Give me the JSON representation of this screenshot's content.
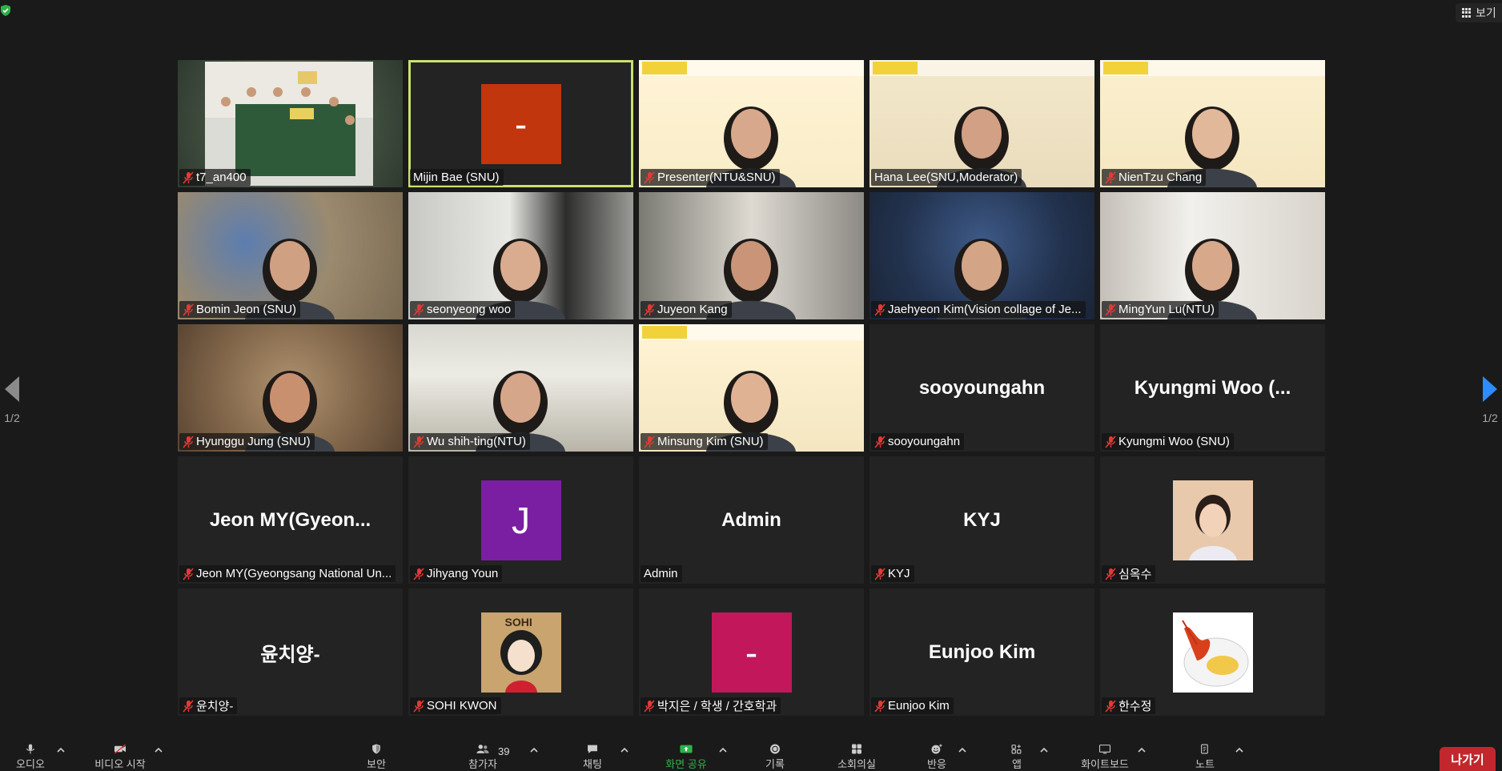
{
  "top": {
    "view_label": "보기"
  },
  "pagination": {
    "left": "1/2",
    "right": "1/2"
  },
  "colors": {
    "speaking_border": "#c9e06f",
    "leave_button": "#c1272d",
    "muted_mic": "#e53935",
    "share_green": "#2cb34a",
    "nav_arrow_right": "#2d8cff"
  },
  "participants": [
    {
      "name": "t7_an400",
      "muted": true,
      "type": "video"
    },
    {
      "name": "Mijin Bae (SNU)",
      "muted": false,
      "type": "square",
      "initial": "-",
      "color": "#c1360c",
      "speaking": true
    },
    {
      "name": "Presenter(NTU&SNU)",
      "muted": true,
      "type": "video"
    },
    {
      "name": "Hana Lee(SNU,Moderator)",
      "muted": false,
      "type": "video"
    },
    {
      "name": "NienTzu Chang",
      "muted": true,
      "type": "video"
    },
    {
      "name": "Bomin Jeon (SNU)",
      "muted": true,
      "type": "video"
    },
    {
      "name": "seonyeong woo",
      "muted": true,
      "type": "video"
    },
    {
      "name": "Juyeon Kang",
      "muted": true,
      "type": "video"
    },
    {
      "name": "Jaehyeon Kim(Vision collage of Je...",
      "muted": true,
      "type": "video"
    },
    {
      "name": "MingYun Lu(NTU)",
      "muted": true,
      "type": "video"
    },
    {
      "name": "Hyunggu Jung (SNU)",
      "muted": true,
      "type": "video"
    },
    {
      "name": "Wu shih-ting(NTU)",
      "muted": true,
      "type": "video"
    },
    {
      "name": "Minsung Kim (SNU)",
      "muted": true,
      "type": "video"
    },
    {
      "name": "sooyoungahn",
      "muted": true,
      "type": "text",
      "display": "sooyoungahn"
    },
    {
      "name": "Kyungmi Woo (SNU)",
      "muted": true,
      "type": "text",
      "display": "Kyungmi Woo (..."
    },
    {
      "name": "Jeon MY(Gyeongsang National Un...",
      "muted": true,
      "type": "text",
      "display": "Jeon MY(Gyeon..."
    },
    {
      "name": "Jihyang Youn",
      "muted": true,
      "type": "square",
      "initial": "J",
      "color": "#7b1fa2"
    },
    {
      "name": "Admin",
      "muted": false,
      "type": "text",
      "display": "Admin"
    },
    {
      "name": "KYJ",
      "muted": true,
      "type": "text",
      "display": "KYJ"
    },
    {
      "name": "심옥수",
      "muted": true,
      "type": "photo",
      "photo": "woman-portrait"
    },
    {
      "name": "윤치양-",
      "muted": true,
      "type": "text",
      "display": "윤치양-"
    },
    {
      "name": "SOHI KWON",
      "muted": true,
      "type": "photo",
      "photo": "sohi-cartoon",
      "photo_text": "SOHI"
    },
    {
      "name": "박지은 / 학생 / 간호학과",
      "muted": true,
      "type": "square",
      "initial": "-",
      "color": "#c2185b"
    },
    {
      "name": "Eunjoo Kim",
      "muted": true,
      "type": "text",
      "display": "Eunjoo Kim"
    },
    {
      "name": "한수정",
      "muted": true,
      "type": "photo",
      "photo": "lobster-dish"
    }
  ],
  "toolbar": {
    "audio_label": "오디오",
    "video_label": "비디오 시작",
    "security_label": "보안",
    "participants_label": "참가자",
    "participants_count": "39",
    "chat_label": "채팅",
    "share_label": "화면 공유",
    "record_label": "기록",
    "apps_label": "소회의실",
    "reactions_label": "반응",
    "apps2_label": "앱",
    "whiteboard_label": "화이트보드",
    "notes_label": "노트",
    "leave_label": "나가기"
  }
}
